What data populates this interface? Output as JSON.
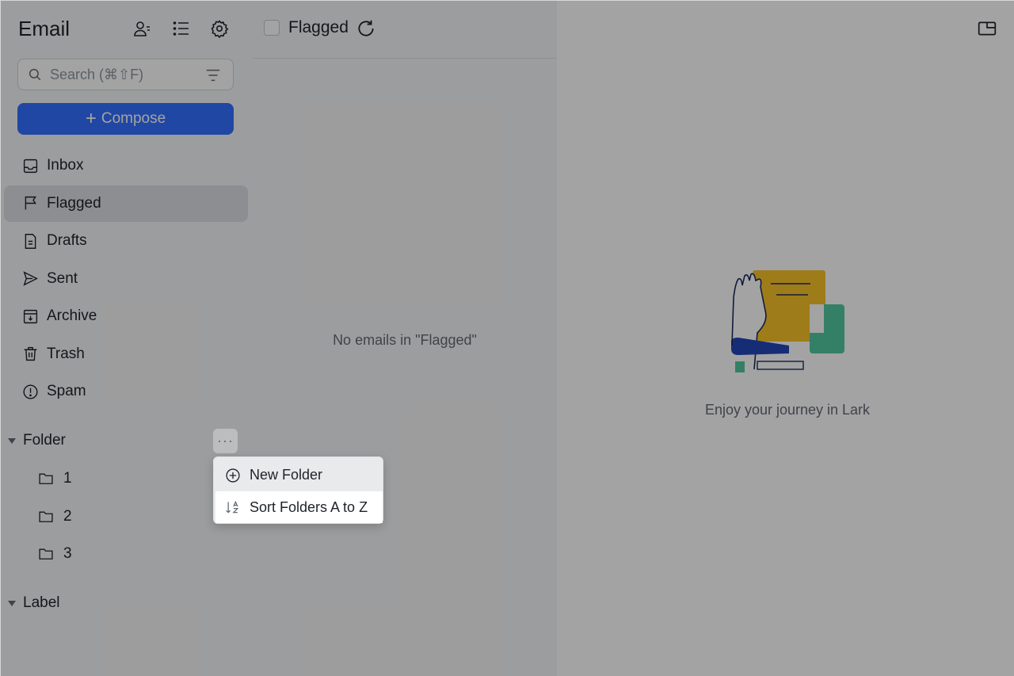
{
  "app": {
    "title": "Email"
  },
  "search": {
    "placeholder": "Search (⌘⇧F)"
  },
  "compose": {
    "label": "Compose"
  },
  "nav": {
    "items": [
      {
        "label": "Inbox",
        "icon": "inbox-icon"
      },
      {
        "label": "Flagged",
        "icon": "flag-icon",
        "active": true
      },
      {
        "label": "Drafts",
        "icon": "draft-icon"
      },
      {
        "label": "Sent",
        "icon": "send-icon"
      },
      {
        "label": "Archive",
        "icon": "archive-icon"
      },
      {
        "label": "Trash",
        "icon": "trash-icon"
      },
      {
        "label": "Spam",
        "icon": "spam-icon"
      }
    ]
  },
  "folder_section": {
    "label": "Folder",
    "folders": [
      {
        "label": "1"
      },
      {
        "label": "2"
      },
      {
        "label": "3"
      }
    ]
  },
  "label_section": {
    "label": "Label"
  },
  "context_menu": {
    "items": [
      {
        "label": "New Folder",
        "icon": "add-circle-icon"
      },
      {
        "label": "Sort Folders A to Z",
        "icon": "sort-az-icon"
      }
    ]
  },
  "list": {
    "title": "Flagged",
    "empty_message": "No emails in \"Flagged\""
  },
  "reader": {
    "message": "Enjoy your journey in Lark"
  },
  "colors": {
    "accent": "#3370ff",
    "illus_gold": "#f8c32a",
    "illus_green": "#52c9a0"
  }
}
